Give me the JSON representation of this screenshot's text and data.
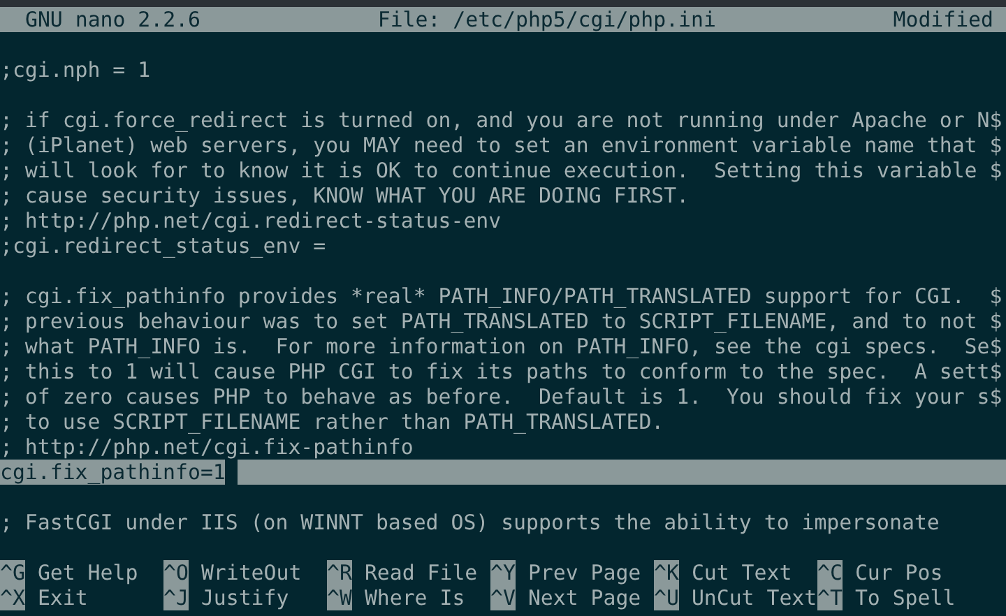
{
  "title_bar": {
    "app": "GNU nano 2.2.6",
    "file": "File: /etc/php5/cgi/php.ini",
    "status": "Modified"
  },
  "lines": [
    {
      "kind": "blank"
    },
    {
      "kind": "text",
      "text": ";cgi.nph = 1",
      "selected": false
    },
    {
      "kind": "blank"
    },
    {
      "kind": "text",
      "text": "; if cgi.force_redirect is turned on, and you are not running under Apache or N$",
      "selected": false
    },
    {
      "kind": "text",
      "text": "; (iPlanet) web servers, you MAY need to set an environment variable name that $",
      "selected": false
    },
    {
      "kind": "text",
      "text": "; will look for to know it is OK to continue execution.  Setting this variable $",
      "selected": false
    },
    {
      "kind": "text",
      "text": "; cause security issues, KNOW WHAT YOU ARE DOING FIRST.",
      "selected": false
    },
    {
      "kind": "text",
      "text": "; http://php.net/cgi.redirect-status-env",
      "selected": false
    },
    {
      "kind": "text",
      "text": ";cgi.redirect_status_env =",
      "selected": false
    },
    {
      "kind": "blank"
    },
    {
      "kind": "text",
      "text": "; cgi.fix_pathinfo provides *real* PATH_INFO/PATH_TRANSLATED support for CGI.  $",
      "selected": false
    },
    {
      "kind": "text",
      "text": "; previous behaviour was to set PATH_TRANSLATED to SCRIPT_FILENAME, and to not $",
      "selected": false
    },
    {
      "kind": "text",
      "text": "; what PATH_INFO is.  For more information on PATH_INFO, see the cgi specs.  Se$",
      "selected": false
    },
    {
      "kind": "text",
      "text": "; this to 1 will cause PHP CGI to fix its paths to conform to the spec.  A sett$",
      "selected": false
    },
    {
      "kind": "text",
      "text": "; of zero causes PHP to behave as before.  Default is 1.  You should fix your s$",
      "selected": false
    },
    {
      "kind": "text",
      "text": "; to use SCRIPT_FILENAME rather than PATH_TRANSLATED.",
      "selected": false
    },
    {
      "kind": "text",
      "text": "; http://php.net/cgi.fix-pathinfo",
      "selected": false
    },
    {
      "kind": "text",
      "text": "cgi.fix_pathinfo=1",
      "selected": true
    },
    {
      "kind": "blank"
    },
    {
      "kind": "text",
      "text": "; FastCGI under IIS (on WINNT based OS) supports the ability to impersonate",
      "selected": false
    },
    {
      "kind": "blank"
    }
  ],
  "shortcuts": [
    [
      {
        "key": "^G",
        "label": "Get Help"
      },
      {
        "key": "^O",
        "label": "WriteOut"
      },
      {
        "key": "^R",
        "label": "Read File"
      },
      {
        "key": "^Y",
        "label": "Prev Page"
      },
      {
        "key": "^K",
        "label": "Cut Text"
      },
      {
        "key": "^C",
        "label": "Cur Pos"
      }
    ],
    [
      {
        "key": "^X",
        "label": "Exit"
      },
      {
        "key": "^J",
        "label": "Justify"
      },
      {
        "key": "^W",
        "label": "Where Is"
      },
      {
        "key": "^V",
        "label": "Next Page"
      },
      {
        "key": "^U",
        "label": "UnCut Text"
      },
      {
        "key": "^T",
        "label": "To Spell"
      }
    ]
  ]
}
